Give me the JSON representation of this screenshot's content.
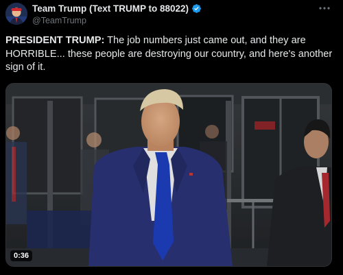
{
  "author": {
    "display_name": "Team Trump (Text TRUMP to 88022)",
    "handle": "@TeamTrump",
    "verified_icon": "verified-badge-icon",
    "avatar_icon": "profile-avatar"
  },
  "menu": {
    "icon": "more-options-icon"
  },
  "tweet": {
    "bold_lead": "PRESIDENT TRUMP:",
    "body": " The job numbers just came out, and they are HORRIBLE... these people are destroying our country, and here's another sign of it."
  },
  "media": {
    "duration": "0:36"
  },
  "colors": {
    "background": "#000000",
    "text": "#e7e9ea",
    "muted": "#71767b",
    "verified": "#1d9bf0",
    "tie": "#1f3fbf",
    "suit": "#2b3478"
  }
}
